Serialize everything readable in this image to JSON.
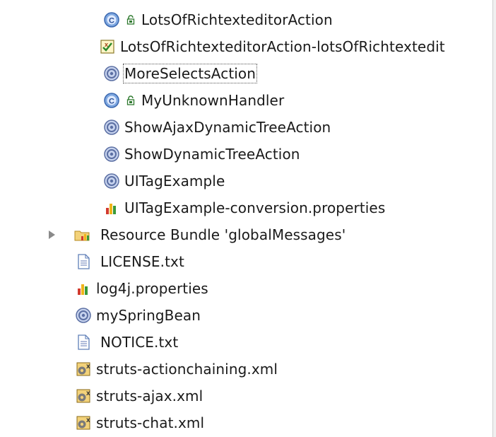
{
  "tree": {
    "items": [
      {
        "label": "LotsOfRichtexteditorAction",
        "icon": "class-icon",
        "locked": true
      },
      {
        "label": "LotsOfRichtexteditorAction-lotsOfRichtextedit",
        "icon": "validation-xml-icon",
        "locked": false
      },
      {
        "label": "MoreSelectsAction",
        "icon": "spring-bean-icon",
        "locked": false,
        "selected": true
      },
      {
        "label": "MyUnknownHandler",
        "icon": "class-icon",
        "locked": true
      },
      {
        "label": "ShowAjaxDynamicTreeAction",
        "icon": "spring-bean-icon",
        "locked": false
      },
      {
        "label": "ShowDynamicTreeAction",
        "icon": "spring-bean-icon",
        "locked": false
      },
      {
        "label": "UITagExample",
        "icon": "spring-bean-icon",
        "locked": false
      },
      {
        "label": "UITagExample-conversion.properties",
        "icon": "properties-icon",
        "locked": false
      },
      {
        "label": "Resource Bundle 'globalMessages'",
        "icon": "resource-bundle-icon",
        "locked": false,
        "collapsed": true
      },
      {
        "label": "LICENSE.txt",
        "icon": "text-file-icon",
        "locked": false
      },
      {
        "label": "log4j.properties",
        "icon": "properties-icon",
        "locked": false
      },
      {
        "label": "mySpringBean",
        "icon": "spring-bean-icon",
        "locked": false
      },
      {
        "label": "NOTICE.txt",
        "icon": "text-file-icon",
        "locked": false
      },
      {
        "label": "struts-actionchaining.xml",
        "icon": "struts-xml-icon",
        "locked": false
      },
      {
        "label": "struts-ajax.xml",
        "icon": "struts-xml-icon",
        "locked": false
      },
      {
        "label": "struts-chat.xml",
        "icon": "struts-xml-icon",
        "locked": false
      }
    ]
  }
}
